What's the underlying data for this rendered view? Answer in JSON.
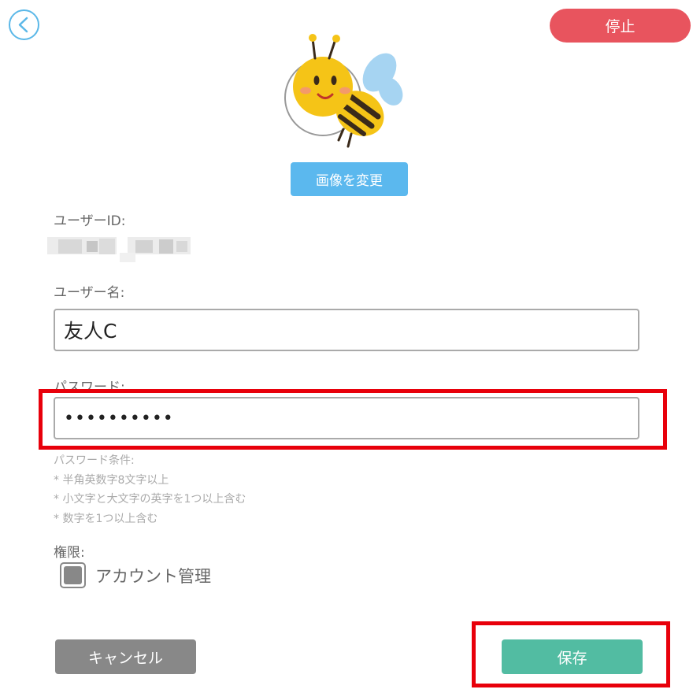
{
  "header": {
    "back_icon": "chevron-left-icon",
    "stop_label": "停止"
  },
  "avatar": {
    "icon": "bee-illustration"
  },
  "change_image_label": "画像を変更",
  "user_id": {
    "label": "ユーザーID:"
  },
  "user_name": {
    "label": "ユーザー名:",
    "value": "友人C"
  },
  "password": {
    "label": "パスワード:",
    "value": "••••••••••",
    "rules_title": "パスワード条件:",
    "rules": [
      "* 半角英数字8文字以上",
      "* 小文字と大文字の英字を1つ以上含む",
      "* 数字を1つ以上含む"
    ]
  },
  "permission": {
    "label": "権限:",
    "option_label": "アカウント管理"
  },
  "footer": {
    "cancel_label": "キャンセル",
    "save_label": "保存"
  },
  "colors": {
    "stop": "#e8545e",
    "change_image": "#5bb8ee",
    "save": "#52bca2",
    "cancel": "#888888",
    "highlight": "#e8000b"
  }
}
